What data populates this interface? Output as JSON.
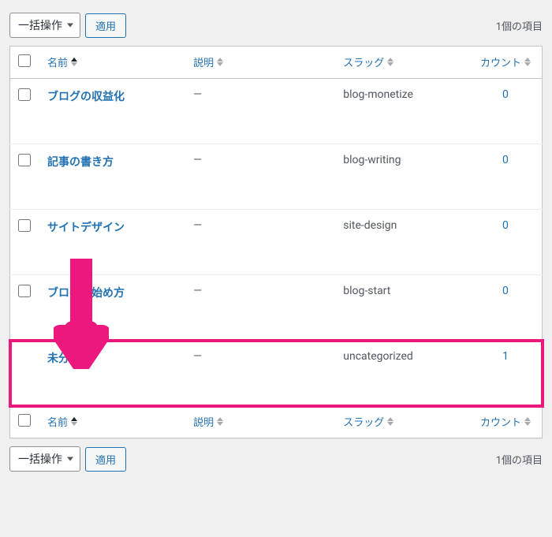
{
  "bulkAction": {
    "label": "一括操作",
    "apply": "適用"
  },
  "itemCount": "1個の項目",
  "columns": {
    "name": "名前",
    "description": "説明",
    "slug": "スラッグ",
    "count": "カウント"
  },
  "rows": [
    {
      "name": "ブログの収益化",
      "description": "—",
      "slug": "blog-monetize",
      "count": "0",
      "hasCheckbox": true,
      "highlight": false
    },
    {
      "name": "記事の書き方",
      "description": "—",
      "slug": "blog-writing",
      "count": "0",
      "hasCheckbox": true,
      "highlight": false
    },
    {
      "name": "サイトデザイン",
      "description": "—",
      "slug": "site-design",
      "count": "0",
      "hasCheckbox": true,
      "highlight": false
    },
    {
      "name": "ブログの始め方",
      "description": "—",
      "slug": "blog-start",
      "count": "0",
      "hasCheckbox": true,
      "highlight": false
    },
    {
      "name": "未分類",
      "description": "—",
      "slug": "uncategorized",
      "count": "1",
      "hasCheckbox": false,
      "highlight": true
    }
  ]
}
